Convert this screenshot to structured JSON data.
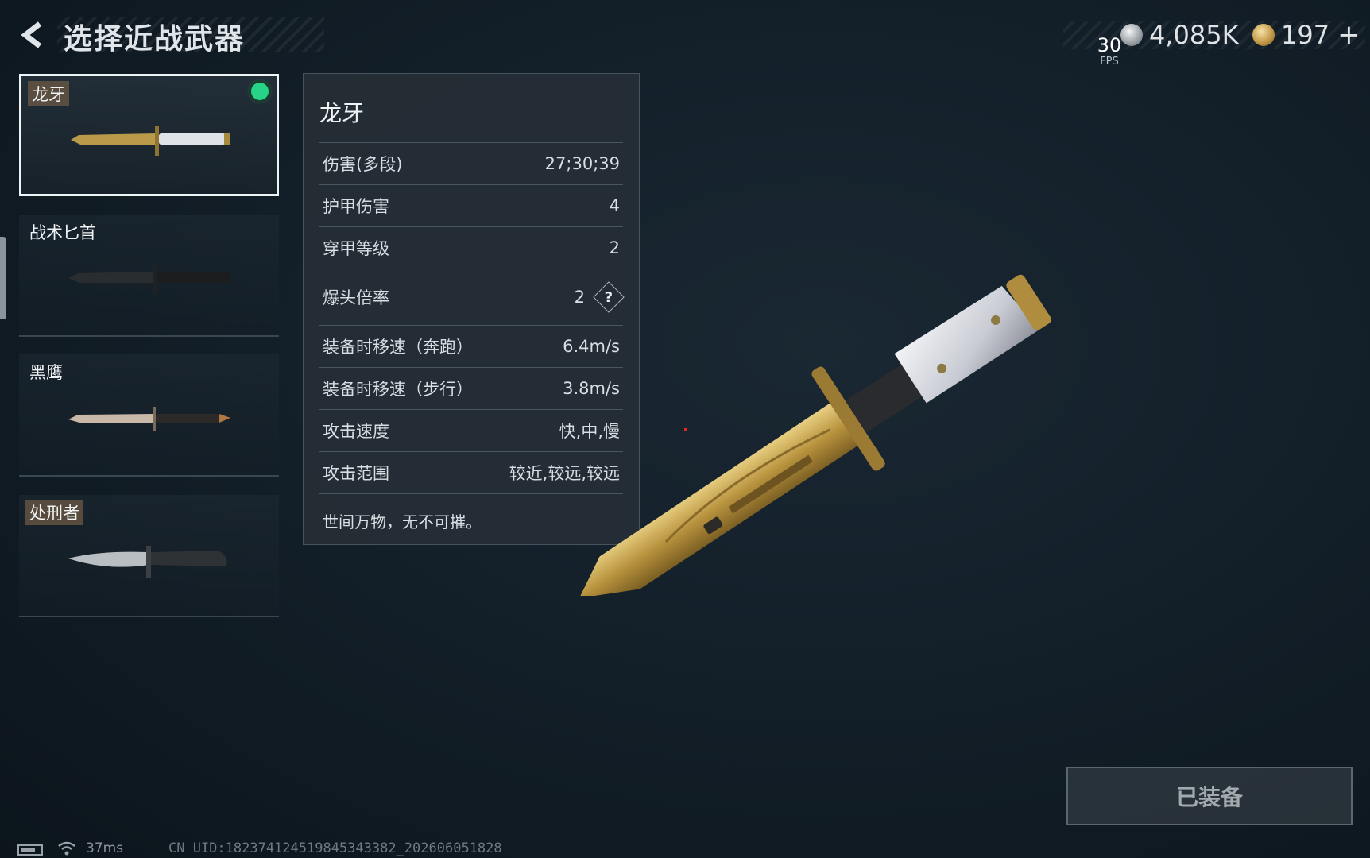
{
  "header": {
    "title": "选择近战武器",
    "back_icon": "back-arrow-icon"
  },
  "hud": {
    "fps_value": "30",
    "fps_label": "FPS",
    "silver_amount": "4,085K",
    "gold_amount": "197",
    "plus_label": "+"
  },
  "weapons": [
    {
      "name": "龙牙",
      "selected": true,
      "equipped": true
    },
    {
      "name": "战术匕首",
      "selected": false,
      "equipped": false
    },
    {
      "name": "黑鹰",
      "selected": false,
      "equipped": false
    },
    {
      "name": "处刑者",
      "selected": false,
      "equipped": false
    }
  ],
  "stats_panel": {
    "title": "龙牙",
    "rows": [
      {
        "label": "伤害(多段)",
        "value": "27;30;39"
      },
      {
        "label": "护甲伤害",
        "value": "4"
      },
      {
        "label": "穿甲等级",
        "value": "2"
      },
      {
        "label": "爆头倍率",
        "value": "2",
        "help": "?"
      },
      {
        "label": "装备时移速（奔跑）",
        "value": "6.4m/s"
      },
      {
        "label": "装备时移速（步行）",
        "value": "3.8m/s"
      },
      {
        "label": "攻击速度",
        "value": "快,中,慢"
      },
      {
        "label": "攻击范围",
        "value": "较近,较远,较远"
      }
    ],
    "flavor": "世间万物，无不可摧。"
  },
  "equip_button": {
    "label": "已装备"
  },
  "status_bar": {
    "ping": "37ms",
    "uid": "CN UID:182374124519845343382_202606051828"
  },
  "colors": {
    "background": "#131f29",
    "equipped_indicator": "#27d487",
    "panel": "#262e36"
  }
}
